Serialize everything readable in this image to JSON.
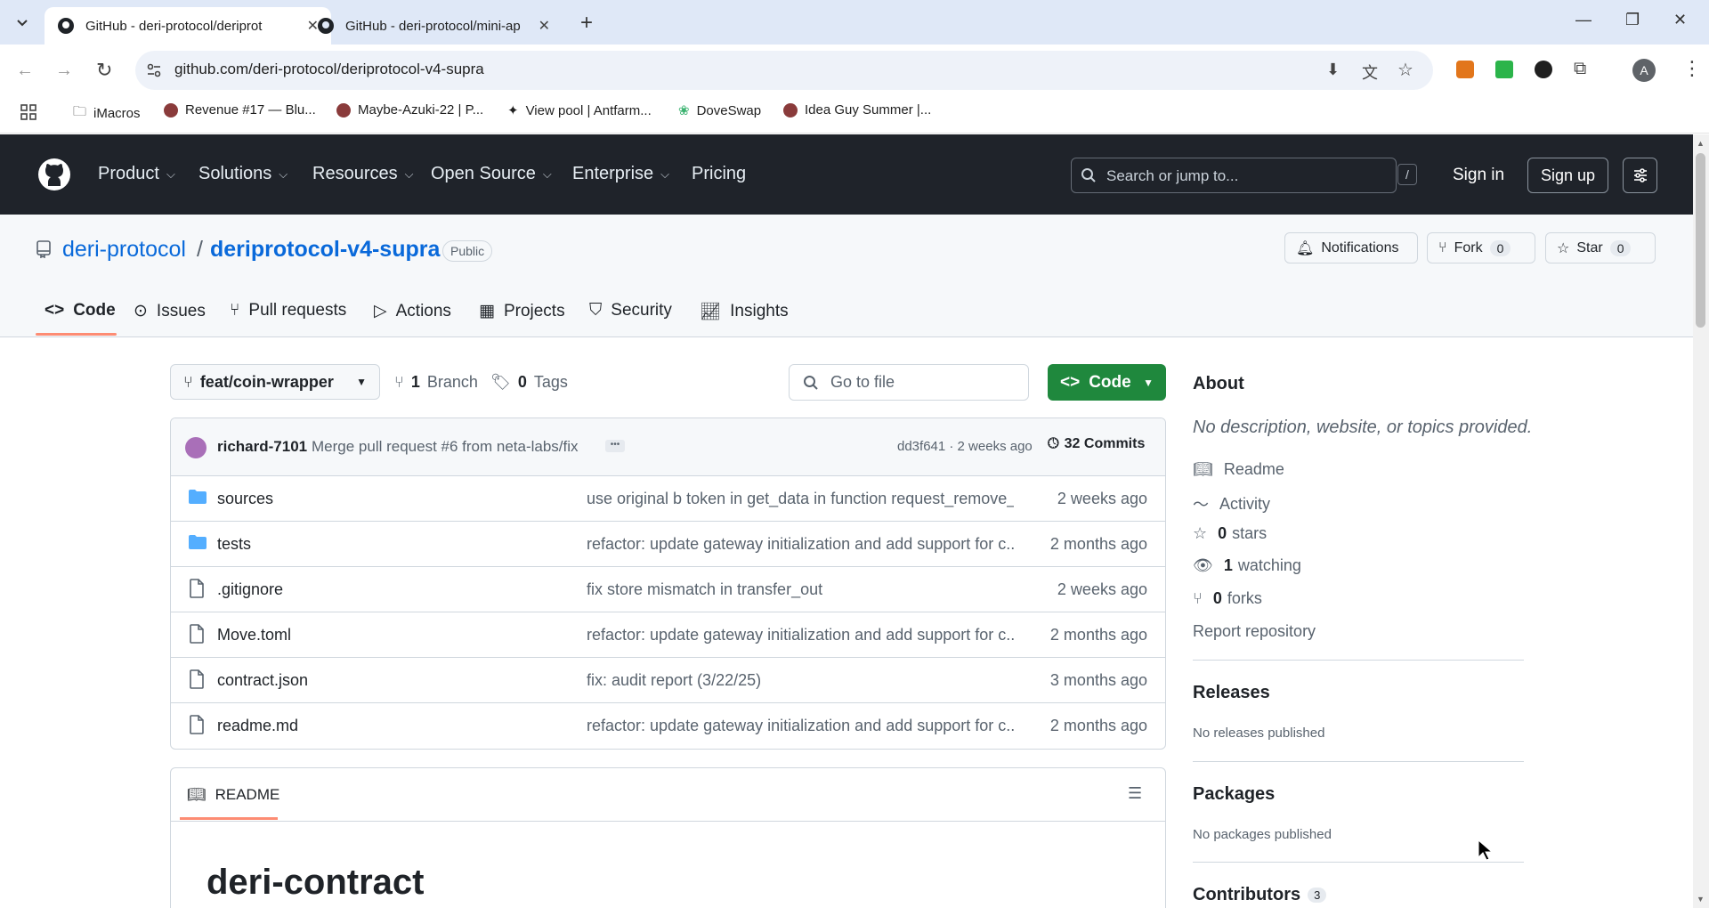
{
  "browser": {
    "tabs": [
      {
        "title": "GitHub - deri-protocol/deriprot",
        "active": true
      },
      {
        "title": "GitHub - deri-protocol/mini-ap",
        "active": false
      }
    ],
    "url": "github.com/deri-protocol/deriprotocol-v4-supra",
    "bookmarks": [
      "iMacros",
      "Revenue #17 — Blu...",
      "Maybe-Azuki-22 | P...",
      "View pool | Antfarm...",
      "DoveSwap",
      "Idea Guy Summer |..."
    ],
    "profile_initial": "A"
  },
  "gh_header": {
    "nav": [
      "Product",
      "Solutions",
      "Resources",
      "Open Source",
      "Enterprise",
      "Pricing"
    ],
    "search_placeholder": "Search or jump to...",
    "slash": "/",
    "sign_in": "Sign in",
    "sign_up": "Sign up"
  },
  "repo": {
    "owner": "deri-protocol",
    "separator": "/",
    "name": "deriprotocol-v4-supra",
    "visibility": "Public",
    "notifications": "Notifications",
    "fork_label": "Fork",
    "fork_count": "0",
    "star_label": "Star",
    "star_count": "0",
    "tabs": [
      "Code",
      "Issues",
      "Pull requests",
      "Actions",
      "Projects",
      "Security",
      "Insights"
    ]
  },
  "code": {
    "branch": "feat/coin-wrapper",
    "branches_count": "1",
    "branches_label": "Branch",
    "tags_count": "0",
    "tags_label": "Tags",
    "goto_placeholder": "Go to file",
    "code_button": "Code",
    "commit": {
      "author": "richard-7101",
      "message": "Merge pull request #6 from neta-labs/fix",
      "meta": "dd3f641 · 2 weeks ago",
      "commits": "32 Commits"
    },
    "files": [
      {
        "name": "sources",
        "type": "dir",
        "message": "use original b token in get_data in function request_remove_...",
        "date": "2 weeks ago"
      },
      {
        "name": "tests",
        "type": "dir",
        "message": "refactor: update gateway initialization and add support for c...",
        "date": "2 months ago"
      },
      {
        "name": ".gitignore",
        "type": "file",
        "message": "fix store mismatch in transfer_out",
        "date": "2 weeks ago"
      },
      {
        "name": "Move.toml",
        "type": "file",
        "message": "refactor: update gateway initialization and add support for c...",
        "date": "2 months ago"
      },
      {
        "name": "contract.json",
        "type": "file",
        "message": "fix: audit report (3/22/25)",
        "date": "3 months ago"
      },
      {
        "name": "readme.md",
        "type": "file",
        "message": "refactor: update gateway initialization and add support for c...",
        "date": "2 months ago"
      }
    ],
    "readme_tab": "README",
    "readme_title": "deri-contract"
  },
  "sidebar": {
    "about_title": "About",
    "about_desc": "No description, website, or topics provided.",
    "readme": "Readme",
    "activity": "Activity",
    "stars_count": "0",
    "stars_label": "stars",
    "watching_count": "1",
    "watching_label": "watching",
    "forks_count": "0",
    "forks_label": "forks",
    "report": "Report repository",
    "releases_title": "Releases",
    "releases_desc": "No releases published",
    "packages_title": "Packages",
    "packages_desc": "No packages published",
    "contributors_title": "Contributors",
    "contributors_count": "3"
  }
}
